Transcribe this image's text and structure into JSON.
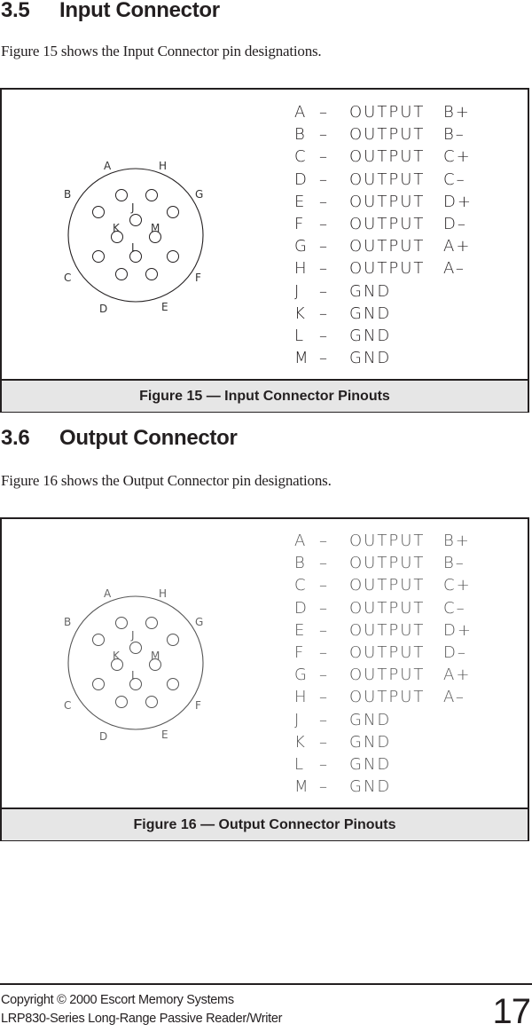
{
  "sections": [
    {
      "number": "3.5",
      "title": "Input Connector",
      "paragraph": "Figure 15 shows the Input Connector pin designations.",
      "figure": {
        "caption": "Figure 15 — Input Connector Pinouts",
        "pinout": [
          {
            "pin": "A",
            "dash": "–",
            "signal_word": "OUTPUT",
            "signal": "B+"
          },
          {
            "pin": "B",
            "dash": "–",
            "signal_word": "OUTPUT",
            "signal": "B–"
          },
          {
            "pin": "C",
            "dash": "–",
            "signal_word": "OUTPUT",
            "signal": "C+"
          },
          {
            "pin": "D",
            "dash": "–",
            "signal_word": "OUTPUT",
            "signal": "C–"
          },
          {
            "pin": "E",
            "dash": "–",
            "signal_word": "OUTPUT",
            "signal": "D+"
          },
          {
            "pin": "F",
            "dash": "–",
            "signal_word": "OUTPUT",
            "signal": "D–"
          },
          {
            "pin": "G",
            "dash": "–",
            "signal_word": "OUTPUT",
            "signal": "A+"
          },
          {
            "pin": "H",
            "dash": "–",
            "signal_word": "OUTPUT",
            "signal": "A–"
          },
          {
            "pin": "J",
            "dash": "–",
            "signal_word": "GND",
            "signal": ""
          },
          {
            "pin": "K",
            "dash": "–",
            "signal_word": "GND",
            "signal": ""
          },
          {
            "pin": "L",
            "dash": "–",
            "signal_word": "GND",
            "signal": ""
          },
          {
            "pin": "M",
            "dash": "–",
            "signal_word": "GND",
            "signal": ""
          }
        ],
        "connector_labels": {
          "A": "A",
          "B": "B",
          "C": "C",
          "D": "D",
          "E": "E",
          "F": "F",
          "G": "G",
          "H": "H",
          "J": "J",
          "K": "K",
          "L": "L",
          "M": "M"
        }
      }
    },
    {
      "number": "3.6",
      "title": "Output Connector",
      "paragraph": "Figure 16 shows the Output Connector pin designations.",
      "figure": {
        "caption": "Figure 16 — Output Connector Pinouts",
        "pinout": [
          {
            "pin": "A",
            "dash": "–",
            "signal_word": "OUTPUT",
            "signal": "B+"
          },
          {
            "pin": "B",
            "dash": "–",
            "signal_word": "OUTPUT",
            "signal": "B–"
          },
          {
            "pin": "C",
            "dash": "–",
            "signal_word": "OUTPUT",
            "signal": "C+"
          },
          {
            "pin": "D",
            "dash": "–",
            "signal_word": "OUTPUT",
            "signal": "C–"
          },
          {
            "pin": "E",
            "dash": "–",
            "signal_word": "OUTPUT",
            "signal": "D+"
          },
          {
            "pin": "F",
            "dash": "–",
            "signal_word": "OUTPUT",
            "signal": "D–"
          },
          {
            "pin": "G",
            "dash": "–",
            "signal_word": "OUTPUT",
            "signal": "A+"
          },
          {
            "pin": "H",
            "dash": "–",
            "signal_word": "OUTPUT",
            "signal": "A–"
          },
          {
            "pin": "J",
            "dash": "–",
            "signal_word": "GND",
            "signal": ""
          },
          {
            "pin": "K",
            "dash": "–",
            "signal_word": "GND",
            "signal": ""
          },
          {
            "pin": "L",
            "dash": "–",
            "signal_word": "GND",
            "signal": ""
          },
          {
            "pin": "M",
            "dash": "–",
            "signal_word": "GND",
            "signal": ""
          }
        ],
        "connector_labels": {
          "A": "A",
          "B": "B",
          "C": "C",
          "D": "D",
          "E": "E",
          "F": "F",
          "G": "G",
          "H": "H",
          "J": "J",
          "K": "K",
          "L": "L",
          "M": "M"
        }
      }
    }
  ],
  "footer": {
    "copyright": "Copyright © 2000 Escort Memory Systems",
    "product": "LRP830-Series Long-Range Passive Reader/Writer",
    "page_number": "17"
  }
}
